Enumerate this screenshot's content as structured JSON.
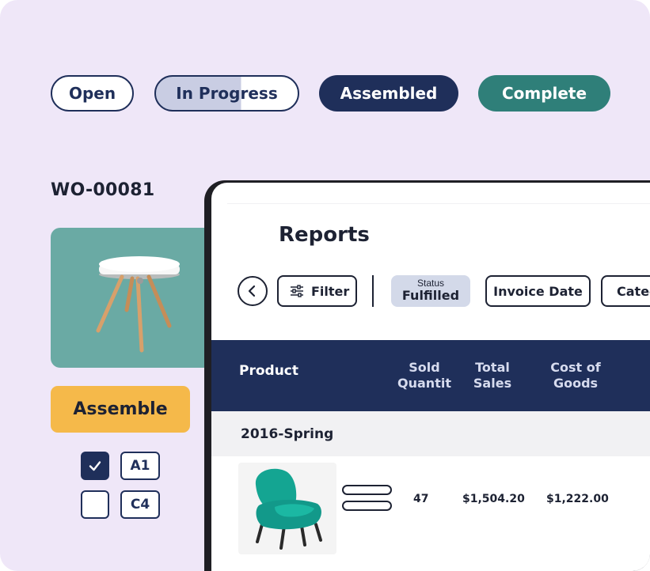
{
  "status_pills": {
    "open": "Open",
    "in_progress": "In Progress",
    "assembled": "Assembled",
    "complete": "Complete"
  },
  "work_order": {
    "number": "WO-00081",
    "action_button": "Assemble",
    "checklist": [
      {
        "checked": true,
        "tag": "A1"
      },
      {
        "checked": false,
        "tag": "C4"
      }
    ]
  },
  "reports": {
    "title": "Reports",
    "filter_label": "Filter",
    "status_chip": {
      "label": "Status",
      "value": "Fulfilled"
    },
    "invoice_date_chip": "Invoice Date",
    "category_chip": "Categ",
    "table": {
      "headers": {
        "product": "Product",
        "sold_quantity": [
          "Sold",
          "Quantit"
        ],
        "total_sales": [
          "Total",
          "Sales"
        ],
        "cost_of_goods": [
          "Cost of",
          "Goods"
        ]
      },
      "group": "2016-Spring",
      "rows": [
        {
          "sold_quantity": "47",
          "total_sales": "$1,504.20",
          "cost_of_goods": "$1,222.00"
        }
      ]
    }
  },
  "colors": {
    "background": "#efe7f8",
    "navy": "#1f2f5a",
    "teal": "#2f7f79",
    "tile_teal": "#6aaaa4",
    "amber": "#f5b94a",
    "status_chip_bg": "#d3d9e9"
  },
  "icons": [
    "chevron-left-icon",
    "filter-sliders-icon",
    "checkmark-icon",
    "table-icon",
    "armchair-icon"
  ]
}
